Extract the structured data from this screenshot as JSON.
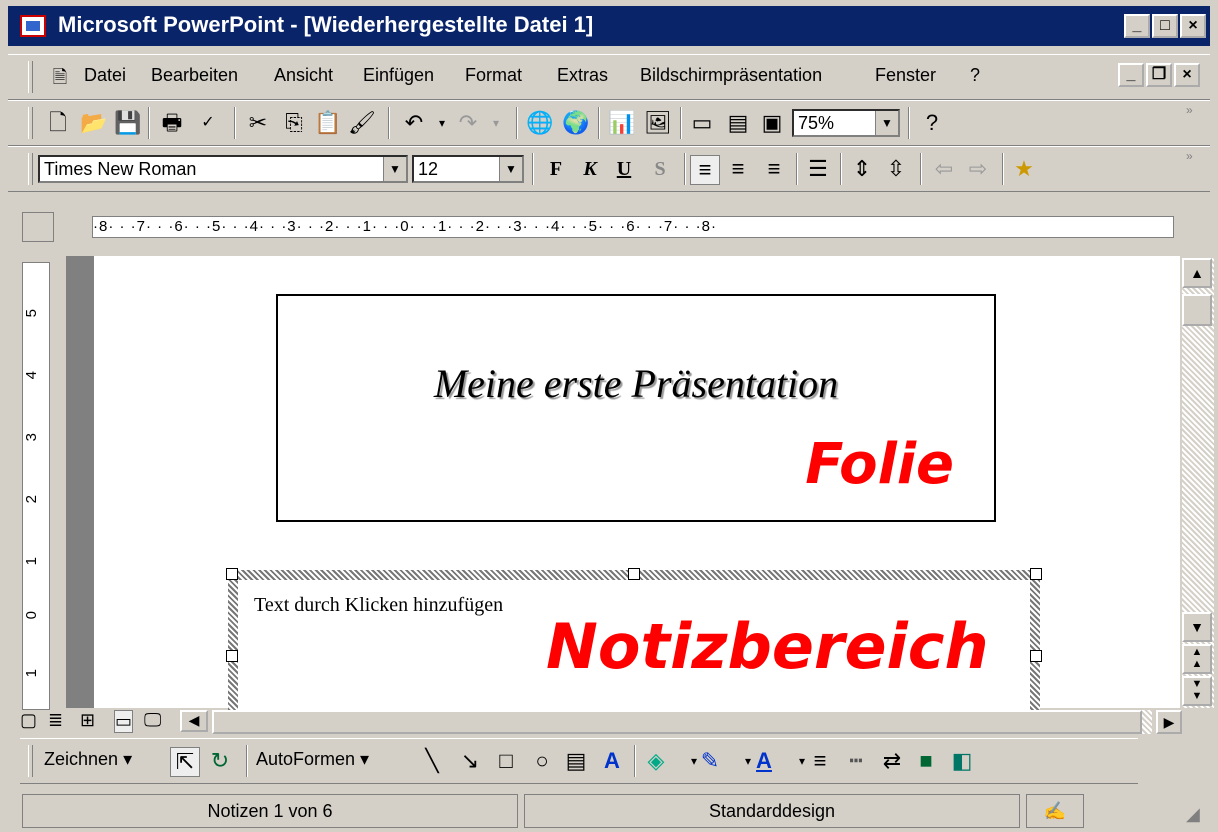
{
  "window": {
    "title": "Microsoft PowerPoint - [Wiederhergestellte Datei 1]",
    "minimize": "_",
    "maximize": "□",
    "close": "×",
    "doc_minimize": "_",
    "doc_restore": "❐",
    "doc_close": "×"
  },
  "menu": {
    "items": [
      {
        "label": "Datei"
      },
      {
        "label": "Bearbeiten"
      },
      {
        "label": "Ansicht"
      },
      {
        "label": "Einfügen"
      },
      {
        "label": "Format"
      },
      {
        "label": "Extras"
      },
      {
        "label": "Bildschirmpräsentation"
      },
      {
        "label": "Fenster"
      },
      {
        "label": "?"
      }
    ]
  },
  "standard_toolbar": {
    "zoom": "75%"
  },
  "format_toolbar": {
    "font": "Times New Roman",
    "size": "12",
    "bold": "F",
    "italic": "K",
    "underline": "U",
    "shadow": "S"
  },
  "ruler": {
    "horizontal": "·8· · ·7· · ·6· · ·5· · ·4· · ·3· · ·2· · ·1· · ·0· · ·1· · ·2· · ·3· · ·4· · ·5· · ·6· · ·7· · ·8·",
    "vertical": [
      "5",
      "4",
      "3",
      "2",
      "1",
      "0",
      "1"
    ]
  },
  "slide": {
    "title": "Meine erste Präsentation",
    "label": "Folie"
  },
  "notes": {
    "placeholder": "Text durch Klicken hinzufügen",
    "label": "Notizbereich"
  },
  "drawing_toolbar": {
    "draw": "Zeichnen",
    "autoshapes": "AutoFormen"
  },
  "statusbar": {
    "page": "Notizen 1 von 6",
    "design": "Standarddesign"
  },
  "colors": {
    "titlebar": "#0a246a",
    "label_red": "#ff0000",
    "face": "#d4d0c8"
  }
}
